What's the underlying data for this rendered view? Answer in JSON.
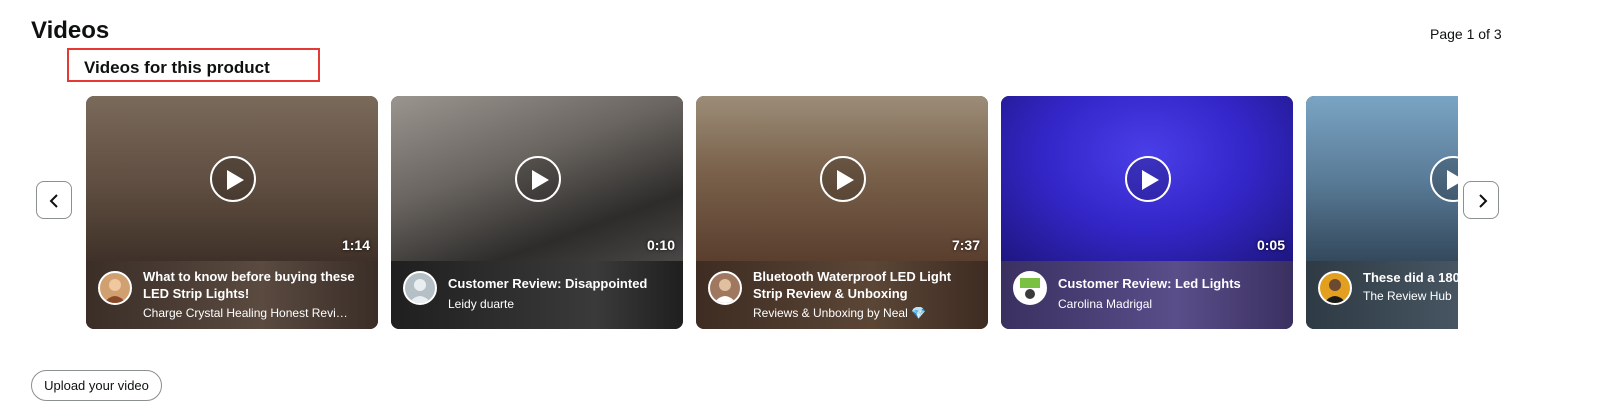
{
  "header": {
    "title": "Videos",
    "page_indicator": "Page 1 of 3",
    "subtitle": "Videos for this product"
  },
  "videos": [
    {
      "title": "What to know before buying these LED Strip Lights!",
      "creator": "Charge Crystal Healing Honest Revi…",
      "duration": "1:14",
      "bg_top": "#6b5a4c",
      "bg_bottom": "#4a3b31",
      "avatar_color": "#d0a070"
    },
    {
      "title": "Customer Review: Disappointed",
      "creator": "Leidy duarte",
      "duration": "0:10",
      "bg_top": "#8a8580",
      "bg_bottom": "#2b2a29",
      "avatar_color": "#b5bfc6"
    },
    {
      "title": "Bluetooth Waterproof LED Light Strip Review & Unboxing",
      "creator": "Reviews & Unboxing by Neal 💎",
      "duration": "7:37",
      "bg_top": "#8a7a66",
      "bg_bottom": "#5a3f30",
      "avatar_color": "#a07860"
    },
    {
      "title": "Customer Review: Led Lights",
      "creator": "Carolina Madrigal",
      "duration": "0:05",
      "bg_top": "#3b2ed0",
      "bg_bottom": "#1d1778",
      "avatar_color": "#7ac043"
    },
    {
      "title": "These did a 180",
      "creator": "The Review Hub",
      "duration": "",
      "bg_top": "#6a90b0",
      "bg_bottom": "#2e4054",
      "avatar_color": "#e3a020"
    }
  ],
  "buttons": {
    "upload": "Upload your video"
  },
  "icons": {
    "prev": "chevron-left-icon",
    "next": "chevron-right-icon",
    "play": "play-icon"
  }
}
